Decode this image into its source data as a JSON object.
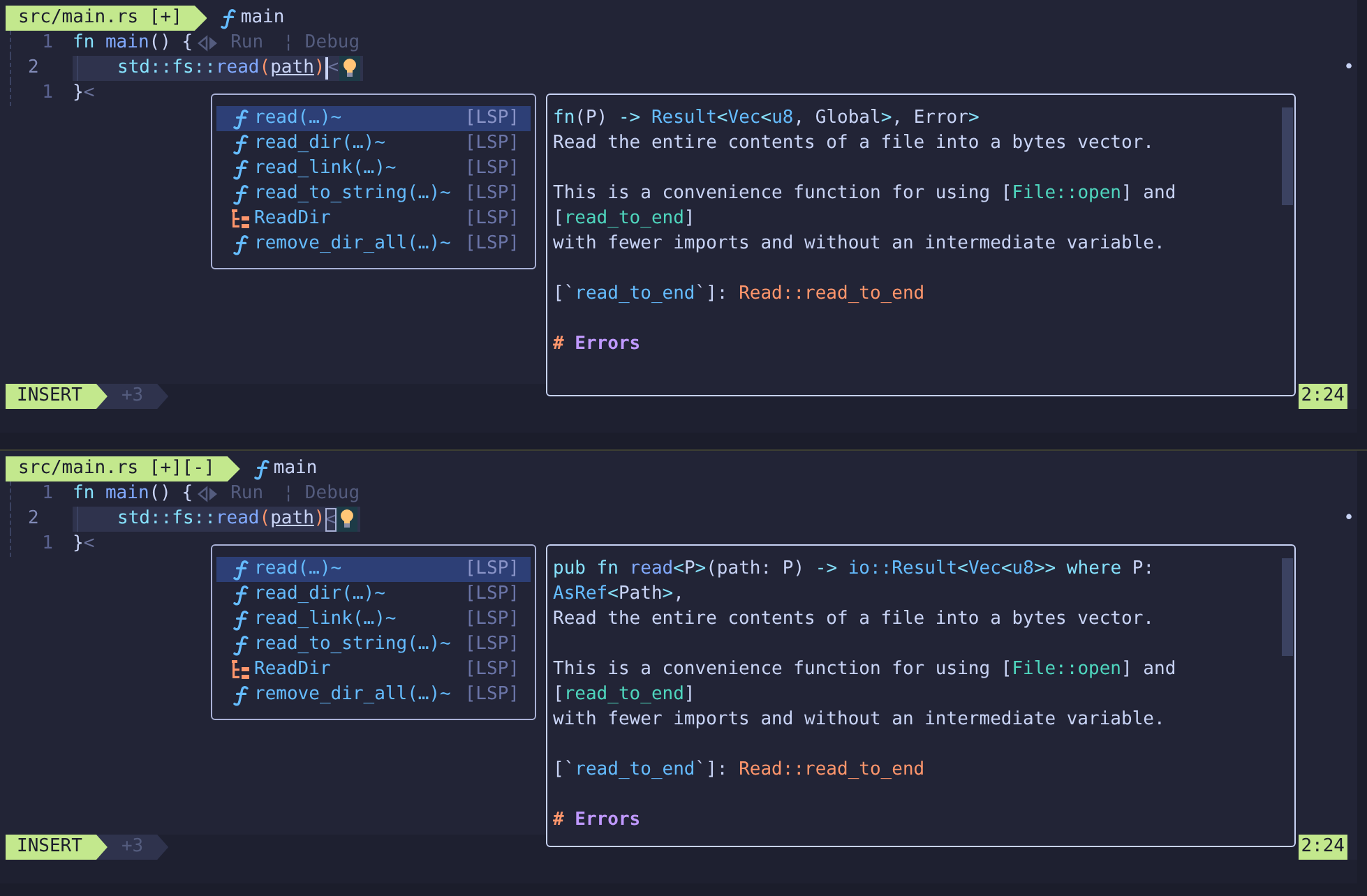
{
  "panes": [
    {
      "tab": {
        "file": "src/main.rs [+]"
      },
      "breadcrumb": {
        "kind": "function",
        "name": "main"
      },
      "lines": [
        {
          "number": "1",
          "current": false,
          "code": [
            {
              "kind": "keyword",
              "text": "fn "
            },
            {
              "kind": "function",
              "text": "main"
            },
            {
              "kind": "plain",
              "text": "() {"
            }
          ],
          "lens": {
            "items": [
              "Run",
              "Debug"
            ],
            "separator": "¦"
          }
        },
        {
          "number": "2",
          "current": true,
          "indent_guide": true,
          "code": [
            {
              "kind": "namespace",
              "text": "std"
            },
            {
              "kind": "punct",
              "text": "::"
            },
            {
              "kind": "namespace",
              "text": "fs"
            },
            {
              "kind": "punct",
              "text": "::"
            },
            {
              "kind": "function",
              "text": "read"
            },
            {
              "kind": "paren",
              "text": "("
            },
            {
              "kind": "param",
              "text": "path"
            },
            {
              "kind": "paren",
              "text": ")"
            }
          ],
          "block_cursor": false,
          "eol": "<",
          "code_action": true,
          "marker": "•"
        },
        {
          "number": "1",
          "current": false,
          "code": [
            {
              "kind": "plain",
              "text": "}"
            }
          ],
          "eol": "<"
        }
      ],
      "completion": [
        {
          "kind": "function",
          "label": "read(…)~",
          "source": "[LSP]",
          "selected": true
        },
        {
          "kind": "function",
          "label": "read_dir(…)~",
          "source": "[LSP]",
          "selected": false
        },
        {
          "kind": "function",
          "label": "read_link(…)~",
          "source": "[LSP]",
          "selected": false
        },
        {
          "kind": "function",
          "label": "read_to_string(…)~",
          "source": "[LSP]",
          "selected": false
        },
        {
          "kind": "struct",
          "label": "ReadDir",
          "source": "[LSP]",
          "selected": false
        },
        {
          "kind": "function",
          "label": "remove_dir_all(…)~",
          "source": "[LSP]",
          "selected": false
        }
      ],
      "doc": {
        "blocks": [
          {
            "lines": [
              [
                {
                  "kind": "keyword",
                  "text": "fn"
                },
                {
                  "kind": "plain",
                  "text": "(P) "
                },
                {
                  "kind": "op",
                  "text": "-> "
                },
                {
                  "kind": "type",
                  "text": "Result"
                },
                {
                  "kind": "op",
                  "text": "<"
                },
                {
                  "kind": "type",
                  "text": "Vec"
                },
                {
                  "kind": "op",
                  "text": "<"
                },
                {
                  "kind": "type",
                  "text": "u8"
                },
                {
                  "kind": "plain",
                  "text": ", Global"
                },
                {
                  "kind": "op",
                  "text": ">"
                },
                {
                  "kind": "plain",
                  "text": ", Error"
                },
                {
                  "kind": "op",
                  "text": ">"
                }
              ],
              [
                {
                  "kind": "plain",
                  "text": "Read the entire contents of a file into a bytes vector."
                }
              ]
            ]
          },
          {
            "lines": [
              [
                {
                  "kind": "plain",
                  "text": "This is a convenience function for using ["
                },
                {
                  "kind": "link",
                  "text": "File::open"
                },
                {
                  "kind": "plain",
                  "text": "] and"
                }
              ],
              [
                {
                  "kind": "plain",
                  "text": "["
                },
                {
                  "kind": "link",
                  "text": "read_to_end"
                },
                {
                  "kind": "plain",
                  "text": "]"
                }
              ],
              [
                {
                  "kind": "plain",
                  "text": "with fewer imports and without an intermediate variable."
                }
              ]
            ]
          },
          {
            "lines": [
              [
                {
                  "kind": "plain",
                  "text": "[`"
                },
                {
                  "kind": "code",
                  "text": "read_to_end"
                },
                {
                  "kind": "plain",
                  "text": "`]: "
                },
                {
                  "kind": "url",
                  "text": "Read::read_to_end"
                }
              ]
            ]
          },
          {
            "lines": [
              [
                {
                  "kind": "heading_mark",
                  "text": "# "
                },
                {
                  "kind": "heading",
                  "text": "Errors"
                }
              ]
            ]
          }
        ]
      },
      "status": {
        "mode": "INSERT",
        "changes": "+3",
        "position": "2:24"
      }
    },
    {
      "tab": {
        "file": "src/main.rs [+][-]"
      },
      "breadcrumb": {
        "kind": "function",
        "name": "main"
      },
      "lines": [
        {
          "number": "1",
          "current": false,
          "code": [
            {
              "kind": "keyword",
              "text": "fn "
            },
            {
              "kind": "function",
              "text": "main"
            },
            {
              "kind": "plain",
              "text": "() {"
            }
          ],
          "lens": {
            "items": [
              "Run",
              "Debug"
            ],
            "separator": "¦"
          }
        },
        {
          "number": "2",
          "current": true,
          "indent_guide": true,
          "code": [
            {
              "kind": "namespace",
              "text": "std"
            },
            {
              "kind": "punct",
              "text": "::"
            },
            {
              "kind": "namespace",
              "text": "fs"
            },
            {
              "kind": "punct",
              "text": "::"
            },
            {
              "kind": "function",
              "text": "read"
            },
            {
              "kind": "paren",
              "text": "("
            },
            {
              "kind": "param",
              "text": "path"
            },
            {
              "kind": "paren",
              "text": ")"
            }
          ],
          "block_cursor": true,
          "eol": "<",
          "code_action": true,
          "marker": "•"
        },
        {
          "number": "1",
          "current": false,
          "code": [
            {
              "kind": "plain",
              "text": "}"
            }
          ],
          "eol": "<"
        }
      ],
      "completion": [
        {
          "kind": "function",
          "label": "read(…)~",
          "source": "[LSP]",
          "selected": true
        },
        {
          "kind": "function",
          "label": "read_dir(…)~",
          "source": "[LSP]",
          "selected": false
        },
        {
          "kind": "function",
          "label": "read_link(…)~",
          "source": "[LSP]",
          "selected": false
        },
        {
          "kind": "function",
          "label": "read_to_string(…)~",
          "source": "[LSP]",
          "selected": false
        },
        {
          "kind": "struct",
          "label": "ReadDir",
          "source": "[LSP]",
          "selected": false
        },
        {
          "kind": "function",
          "label": "remove_dir_all(…)~",
          "source": "[LSP]",
          "selected": false
        }
      ],
      "doc": {
        "blocks": [
          {
            "lines": [
              [
                {
                  "kind": "keyword",
                  "text": "pub fn "
                },
                {
                  "kind": "function",
                  "text": "read"
                },
                {
                  "kind": "op",
                  "text": "<"
                },
                {
                  "kind": "plain",
                  "text": "P"
                },
                {
                  "kind": "op",
                  "text": ">"
                },
                {
                  "kind": "plain",
                  "text": "(path: P) "
                },
                {
                  "kind": "op",
                  "text": "-> "
                },
                {
                  "kind": "type",
                  "text": "io::Result"
                },
                {
                  "kind": "op",
                  "text": "<"
                },
                {
                  "kind": "type",
                  "text": "Vec"
                },
                {
                  "kind": "op",
                  "text": "<"
                },
                {
                  "kind": "type",
                  "text": "u8"
                },
                {
                  "kind": "op",
                  "text": ">> "
                },
                {
                  "kind": "keyword",
                  "text": "where"
                },
                {
                  "kind": "plain",
                  "text": " P:"
                }
              ],
              [
                {
                  "kind": "type",
                  "text": "AsRef"
                },
                {
                  "kind": "op",
                  "text": "<"
                },
                {
                  "kind": "plain",
                  "text": "Path"
                },
                {
                  "kind": "op",
                  "text": ">"
                },
                {
                  "kind": "plain",
                  "text": ","
                }
              ],
              [
                {
                  "kind": "plain",
                  "text": "Read the entire contents of a file into a bytes vector."
                }
              ]
            ]
          },
          {
            "lines": [
              [
                {
                  "kind": "plain",
                  "text": "This is a convenience function for using ["
                },
                {
                  "kind": "link",
                  "text": "File::open"
                },
                {
                  "kind": "plain",
                  "text": "] and"
                }
              ],
              [
                {
                  "kind": "plain",
                  "text": "["
                },
                {
                  "kind": "link",
                  "text": "read_to_end"
                },
                {
                  "kind": "plain",
                  "text": "]"
                }
              ],
              [
                {
                  "kind": "plain",
                  "text": "with fewer imports and without an intermediate variable."
                }
              ]
            ]
          },
          {
            "lines": [
              [
                {
                  "kind": "plain",
                  "text": "[`"
                },
                {
                  "kind": "code",
                  "text": "read_to_end"
                },
                {
                  "kind": "plain",
                  "text": "`]: "
                },
                {
                  "kind": "url",
                  "text": "Read::read_to_end"
                }
              ]
            ]
          },
          {
            "lines": [
              [
                {
                  "kind": "heading_mark",
                  "text": "# "
                },
                {
                  "kind": "heading",
                  "text": "Errors"
                }
              ]
            ]
          }
        ]
      },
      "status": {
        "mode": "INSERT",
        "changes": "+3",
        "position": "2:24"
      }
    }
  ]
}
